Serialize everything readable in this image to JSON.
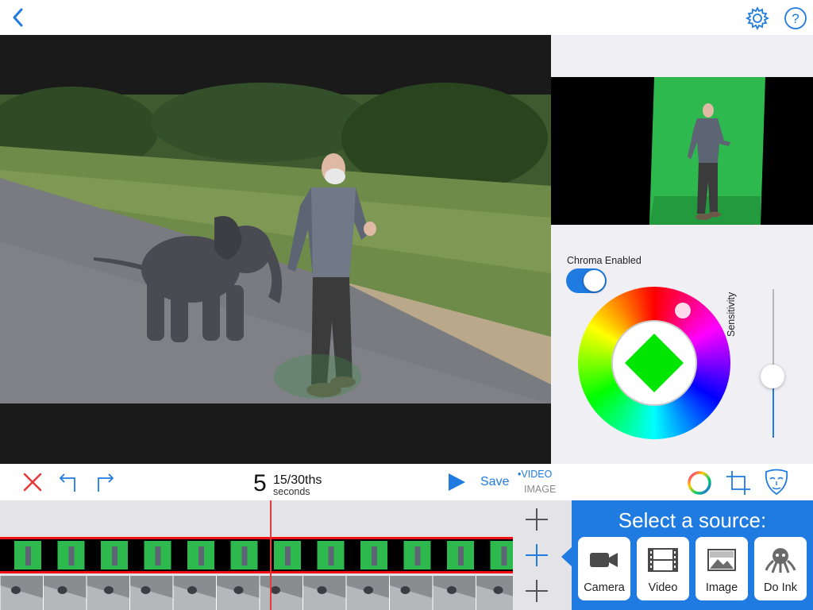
{
  "colors": {
    "accent": "#1f7be0",
    "delete": "#e53a3a",
    "chroma_green": "#2db94d",
    "panel_bg": "#f0eff4"
  },
  "toolbar": {
    "back_icon": "chevron-left-icon",
    "settings_icon": "gear-icon",
    "help_icon": "question-circle-icon"
  },
  "chroma": {
    "label": "Chroma Enabled",
    "enabled": true,
    "sensitivity_label": "Sensitivity",
    "sensitivity_level": 0.4
  },
  "playback": {
    "seconds": "5",
    "frames": "15",
    "frames_suffix": "/30ths",
    "unit": "seconds",
    "save_label": "Save",
    "mode_video": "VIDEO",
    "mode_image": "IMAGE"
  },
  "source_selector": {
    "title": "Select a source:",
    "buttons": [
      {
        "label": "Camera",
        "icon": "video-camera-icon"
      },
      {
        "label": "Video",
        "icon": "film-strip-icon"
      },
      {
        "label": "Image",
        "icon": "picture-icon"
      },
      {
        "label": "Do Ink",
        "icon": "octopus-icon"
      }
    ]
  }
}
